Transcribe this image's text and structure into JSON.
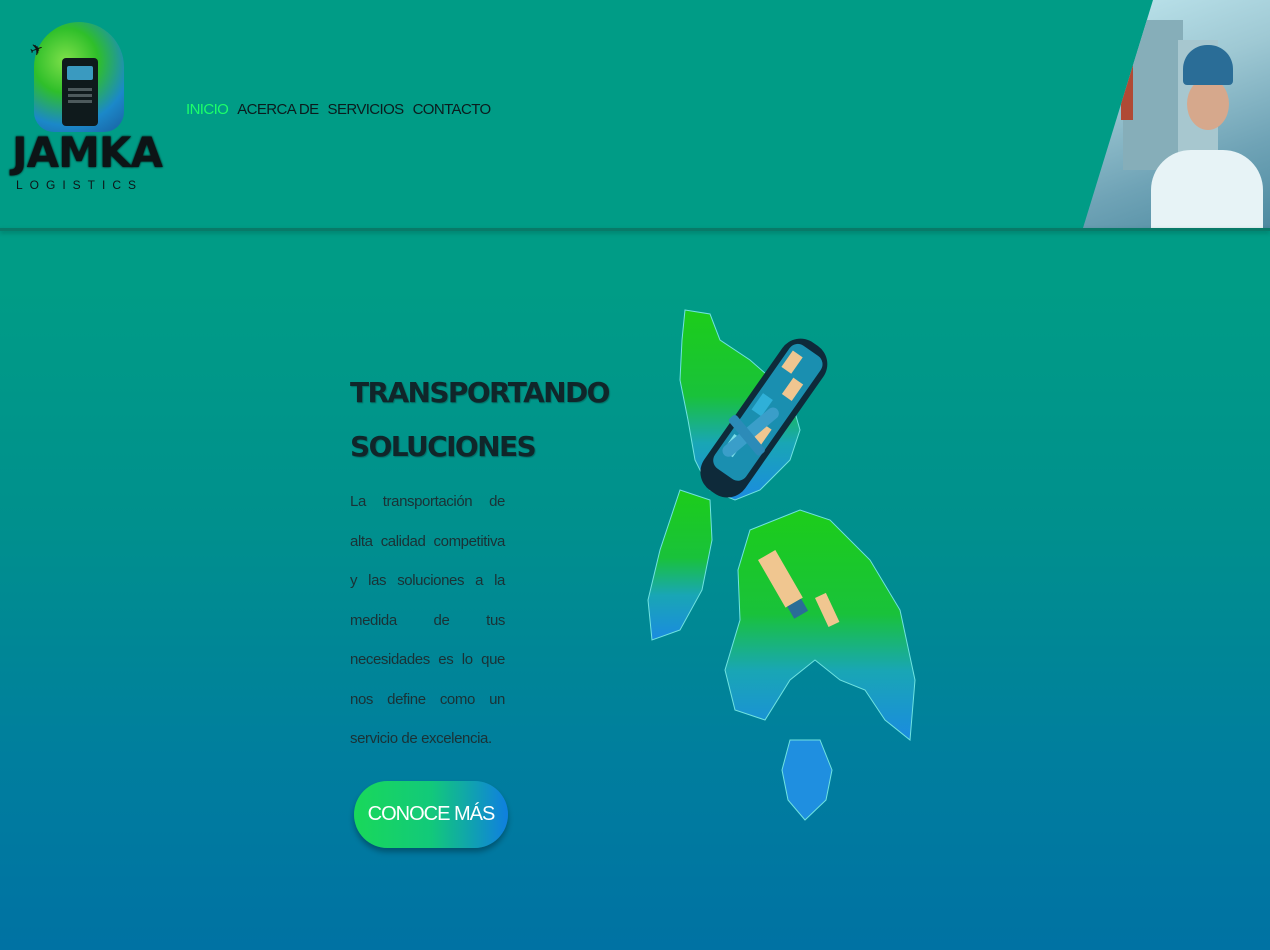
{
  "logo": {
    "text": "JAMKA",
    "subtitle": "LOGISTICS"
  },
  "nav": {
    "items": [
      {
        "label": "INICIO",
        "active": true
      },
      {
        "label": "ACERCA DE",
        "active": false
      },
      {
        "label": "SERVICIOS",
        "active": false
      },
      {
        "label": "CONTACTO",
        "active": false
      }
    ]
  },
  "hero": {
    "title_line1": "TRANSPORTANDO",
    "title_line2": "SOLUCIONES",
    "description": "La transportación de alta calidad competitiva y las soluciones a la medida de tus necesidades es lo que nos define como un servicio de excelencia.",
    "cta_label": "CONOCE MÁS"
  },
  "colors": {
    "background_top": "#009c86",
    "background_bottom": "#0072a3",
    "nav_active": "#1cff6a",
    "nav_text": "#0b1c1e",
    "cta_start": "#19d85a",
    "cta_end": "#0f7fe0"
  },
  "icons": {
    "logo_icon": "globe-truck-icon",
    "plane": "airplane-icon"
  }
}
